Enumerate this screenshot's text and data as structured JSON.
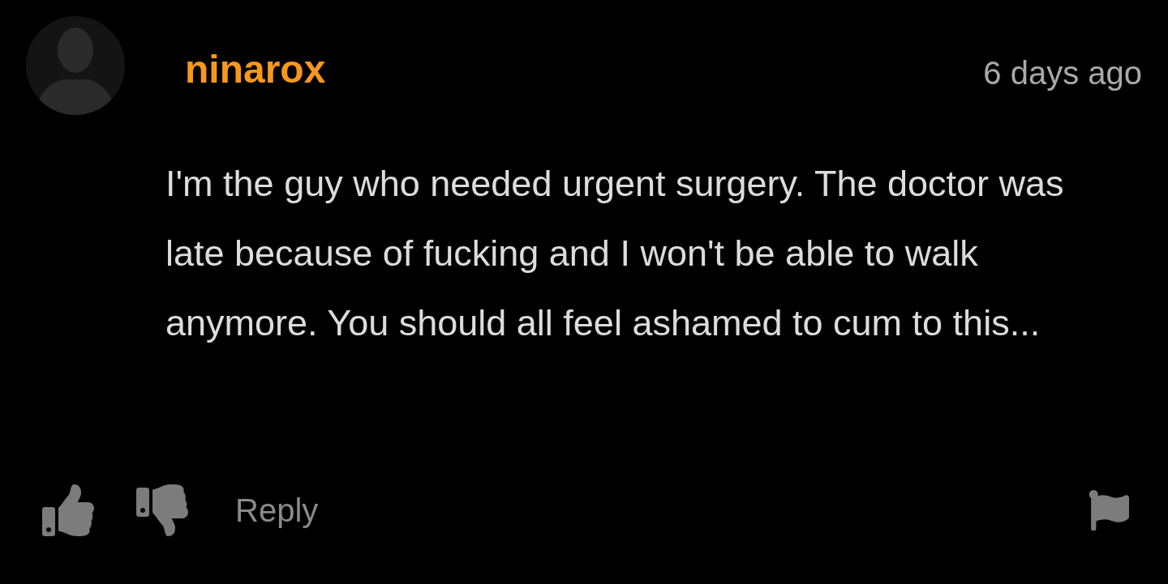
{
  "comment": {
    "username": "ninarox",
    "time": "6 days ago",
    "body": "I'm the guy who needed urgent surgery. The doctor was late because of fucking and I won't be able to walk anymore. You should all feel ashamed to cum to this...",
    "actions": {
      "reply": "Reply"
    }
  }
}
